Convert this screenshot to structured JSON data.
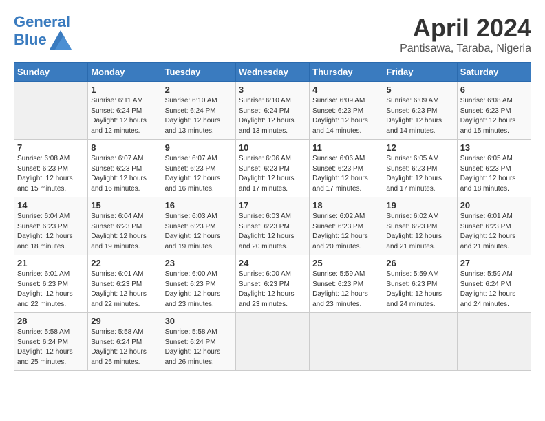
{
  "header": {
    "logo_line1": "General",
    "logo_line2": "Blue",
    "month": "April 2024",
    "location": "Pantisawa, Taraba, Nigeria"
  },
  "weekdays": [
    "Sunday",
    "Monday",
    "Tuesday",
    "Wednesday",
    "Thursday",
    "Friday",
    "Saturday"
  ],
  "weeks": [
    [
      {
        "day": "",
        "sunrise": "",
        "sunset": "",
        "daylight": ""
      },
      {
        "day": "1",
        "sunrise": "6:11 AM",
        "sunset": "6:24 PM",
        "daylight": "12 hours and 12 minutes."
      },
      {
        "day": "2",
        "sunrise": "6:10 AM",
        "sunset": "6:24 PM",
        "daylight": "12 hours and 13 minutes."
      },
      {
        "day": "3",
        "sunrise": "6:10 AM",
        "sunset": "6:24 PM",
        "daylight": "12 hours and 13 minutes."
      },
      {
        "day": "4",
        "sunrise": "6:09 AM",
        "sunset": "6:23 PM",
        "daylight": "12 hours and 14 minutes."
      },
      {
        "day": "5",
        "sunrise": "6:09 AM",
        "sunset": "6:23 PM",
        "daylight": "12 hours and 14 minutes."
      },
      {
        "day": "6",
        "sunrise": "6:08 AM",
        "sunset": "6:23 PM",
        "daylight": "12 hours and 15 minutes."
      }
    ],
    [
      {
        "day": "7",
        "sunrise": "6:08 AM",
        "sunset": "6:23 PM",
        "daylight": "12 hours and 15 minutes."
      },
      {
        "day": "8",
        "sunrise": "6:07 AM",
        "sunset": "6:23 PM",
        "daylight": "12 hours and 16 minutes."
      },
      {
        "day": "9",
        "sunrise": "6:07 AM",
        "sunset": "6:23 PM",
        "daylight": "12 hours and 16 minutes."
      },
      {
        "day": "10",
        "sunrise": "6:06 AM",
        "sunset": "6:23 PM",
        "daylight": "12 hours and 17 minutes."
      },
      {
        "day": "11",
        "sunrise": "6:06 AM",
        "sunset": "6:23 PM",
        "daylight": "12 hours and 17 minutes."
      },
      {
        "day": "12",
        "sunrise": "6:05 AM",
        "sunset": "6:23 PM",
        "daylight": "12 hours and 17 minutes."
      },
      {
        "day": "13",
        "sunrise": "6:05 AM",
        "sunset": "6:23 PM",
        "daylight": "12 hours and 18 minutes."
      }
    ],
    [
      {
        "day": "14",
        "sunrise": "6:04 AM",
        "sunset": "6:23 PM",
        "daylight": "12 hours and 18 minutes."
      },
      {
        "day": "15",
        "sunrise": "6:04 AM",
        "sunset": "6:23 PM",
        "daylight": "12 hours and 19 minutes."
      },
      {
        "day": "16",
        "sunrise": "6:03 AM",
        "sunset": "6:23 PM",
        "daylight": "12 hours and 19 minutes."
      },
      {
        "day": "17",
        "sunrise": "6:03 AM",
        "sunset": "6:23 PM",
        "daylight": "12 hours and 20 minutes."
      },
      {
        "day": "18",
        "sunrise": "6:02 AM",
        "sunset": "6:23 PM",
        "daylight": "12 hours and 20 minutes."
      },
      {
        "day": "19",
        "sunrise": "6:02 AM",
        "sunset": "6:23 PM",
        "daylight": "12 hours and 21 minutes."
      },
      {
        "day": "20",
        "sunrise": "6:01 AM",
        "sunset": "6:23 PM",
        "daylight": "12 hours and 21 minutes."
      }
    ],
    [
      {
        "day": "21",
        "sunrise": "6:01 AM",
        "sunset": "6:23 PM",
        "daylight": "12 hours and 22 minutes."
      },
      {
        "day": "22",
        "sunrise": "6:01 AM",
        "sunset": "6:23 PM",
        "daylight": "12 hours and 22 minutes."
      },
      {
        "day": "23",
        "sunrise": "6:00 AM",
        "sunset": "6:23 PM",
        "daylight": "12 hours and 23 minutes."
      },
      {
        "day": "24",
        "sunrise": "6:00 AM",
        "sunset": "6:23 PM",
        "daylight": "12 hours and 23 minutes."
      },
      {
        "day": "25",
        "sunrise": "5:59 AM",
        "sunset": "6:23 PM",
        "daylight": "12 hours and 23 minutes."
      },
      {
        "day": "26",
        "sunrise": "5:59 AM",
        "sunset": "6:23 PM",
        "daylight": "12 hours and 24 minutes."
      },
      {
        "day": "27",
        "sunrise": "5:59 AM",
        "sunset": "6:24 PM",
        "daylight": "12 hours and 24 minutes."
      }
    ],
    [
      {
        "day": "28",
        "sunrise": "5:58 AM",
        "sunset": "6:24 PM",
        "daylight": "12 hours and 25 minutes."
      },
      {
        "day": "29",
        "sunrise": "5:58 AM",
        "sunset": "6:24 PM",
        "daylight": "12 hours and 25 minutes."
      },
      {
        "day": "30",
        "sunrise": "5:58 AM",
        "sunset": "6:24 PM",
        "daylight": "12 hours and 26 minutes."
      },
      {
        "day": "",
        "sunrise": "",
        "sunset": "",
        "daylight": ""
      },
      {
        "day": "",
        "sunrise": "",
        "sunset": "",
        "daylight": ""
      },
      {
        "day": "",
        "sunrise": "",
        "sunset": "",
        "daylight": ""
      },
      {
        "day": "",
        "sunrise": "",
        "sunset": "",
        "daylight": ""
      }
    ]
  ],
  "labels": {
    "sunrise": "Sunrise: ",
    "sunset": "Sunset: ",
    "daylight": "Daylight: "
  }
}
